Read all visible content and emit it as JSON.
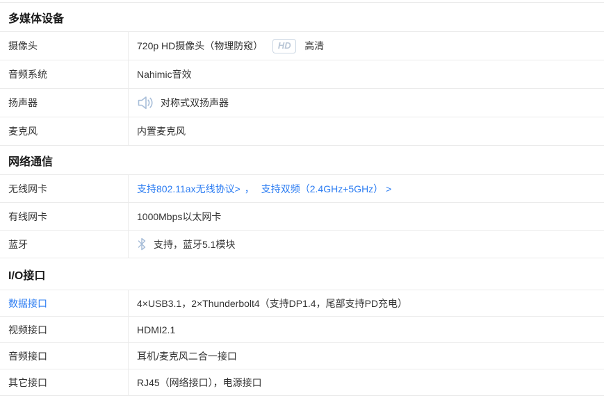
{
  "colors": {
    "link": "#2b7cf2",
    "icon": "#a8bed9",
    "badge_border": "#ccd7e3",
    "badge_text": "#b9c6d6",
    "divider": "#ebebeb",
    "text": "#333333",
    "heading": "#1a1a1a"
  },
  "sections": [
    {
      "title": "多媒体设备",
      "rows": [
        {
          "label": "摄像头",
          "value": "720p HD摄像头（物理防窥）",
          "badge": "HD",
          "badge_suffix": "高清"
        },
        {
          "label": "音频系统",
          "value": "Nahimic音效"
        },
        {
          "label": "扬声器",
          "icon": "speaker-icon",
          "value": "对称式双扬声器"
        },
        {
          "label": "麦克风",
          "value": "内置麦克风"
        }
      ]
    },
    {
      "title": "网络通信",
      "rows": [
        {
          "label": "无线网卡",
          "link1": "支持802.11ax无线协议>",
          "separator": "，",
          "link2": "支持双频（2.4GHz+5GHz） >"
        },
        {
          "label": "有线网卡",
          "value": "1000Mbps以太网卡"
        },
        {
          "label": "蓝牙",
          "icon": "bluetooth-icon",
          "value": "支持，蓝牙5.1模块"
        }
      ]
    },
    {
      "title": "I/O接口",
      "rows": [
        {
          "label": "数据接口",
          "label_is_link": true,
          "value": "4×USB3.1，2×Thunderbolt4（支持DP1.4，尾部支持PD充电）"
        },
        {
          "label": "视频接口",
          "value": "HDMI2.1"
        },
        {
          "label": "音频接口",
          "value": "耳机/麦克风二合一接口"
        },
        {
          "label": "其它接口",
          "value": "RJ45（网络接口），电源接口"
        }
      ]
    }
  ]
}
